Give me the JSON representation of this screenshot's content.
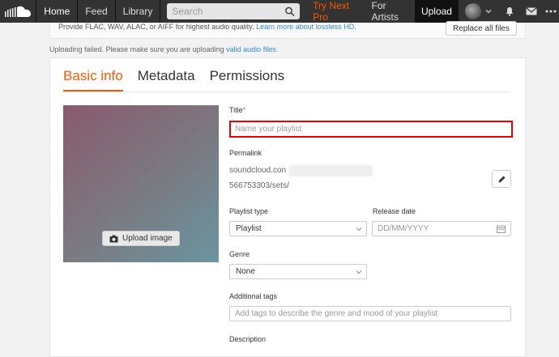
{
  "topbar": {
    "nav": [
      "Home",
      "Feed",
      "Library"
    ],
    "search_placeholder": "Search",
    "try_pro": "Try Next Pro",
    "for_artists": "For Artists",
    "upload": "Upload"
  },
  "banner": {
    "text": "Provide FLAC, WAV, ALAC, or AIFF for highest audio quality.",
    "link": "Learn more about lossless HD.",
    "replace_button": "Replace all files"
  },
  "notice": {
    "text": "Uploading failed. Please make sure you are uploading",
    "link": "valid audio files."
  },
  "tabs": [
    "Basic info",
    "Metadata",
    "Permissions"
  ],
  "form": {
    "upload_image": "Upload image",
    "title_label": "Title",
    "title_required": "*",
    "title_placeholder": "Name your playlist",
    "permalink_label": "Permalink",
    "permalink_line1": "soundcloud.con",
    "permalink_line2": "566753303/sets/",
    "playlist_type_label": "Playlist type",
    "playlist_type_value": "Playlist",
    "release_date_label": "Release date",
    "release_date_placeholder": "DD/MM/YYYY",
    "genre_label": "Genre",
    "genre_value": "None",
    "tags_label": "Additional tags",
    "tags_placeholder": "Add tags to describe the genre and mood of your playlist",
    "description_label": "Description"
  },
  "colors": {
    "accent": "#ff5500",
    "error": "#e00000",
    "link": "#3388dd"
  }
}
